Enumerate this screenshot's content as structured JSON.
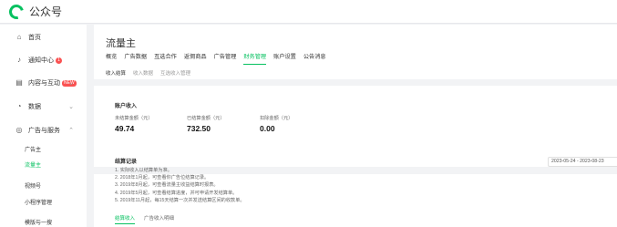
{
  "brand": {
    "name": "公众号",
    "icon": "wechat-official-logo-icon",
    "color": "#07c160"
  },
  "sidebar": {
    "items": [
      {
        "label": "首页",
        "icon": "home-icon"
      },
      {
        "label": "通知中心",
        "icon": "bell-icon",
        "badge": "1"
      },
      {
        "label": "内容与互动",
        "icon": "document-icon",
        "badge": "NEW"
      },
      {
        "label": "数据",
        "icon": "data-icon"
      },
      {
        "label": "广告与服务",
        "icon": "ad-service-icon"
      }
    ],
    "sub_items": [
      {
        "label": "广告主"
      },
      {
        "label": "流量主"
      },
      {
        "label": "视频号"
      },
      {
        "label": "小程序管理"
      },
      {
        "label": "模版与一搜"
      }
    ]
  },
  "main": {
    "title": "流量主",
    "tabs": [
      "概览",
      "广告数据",
      "互选合作",
      "返佣商品",
      "广告管理",
      "财务管理",
      "账户设置",
      "公告消息"
    ],
    "active_tab": "财务管理",
    "subtabs": [
      "收入结算",
      "收入数据",
      "互选收入管理"
    ],
    "active_subtab": "收入结算",
    "account_income": {
      "title": "账户收入",
      "stats": [
        {
          "label": "未结算金额（元）",
          "value": "49.74"
        },
        {
          "label": "已结算金额（元）",
          "value": "732.50"
        },
        {
          "label": "扣除金额（元）",
          "value": "0.00"
        }
      ]
    },
    "settlement": {
      "title": "结算记录",
      "date_range": "2023-05-24 - 2023-08-23",
      "rules": [
        "1. 实际收入以结算单为准。",
        "2. 2018年1月起，可查看你广告位结算记录。",
        "3. 2019年8月起，可查看流量主收益结算时报表。",
        "4. 2019年5月起，可查看结算进度，并可申请开发结算单。",
        "5. 2019年11月起，每15天结算一次并发送结算区间的收款单。"
      ],
      "tabs": [
        "结算收入",
        "广告收入明细"
      ],
      "active_tab": "结算收入"
    }
  }
}
